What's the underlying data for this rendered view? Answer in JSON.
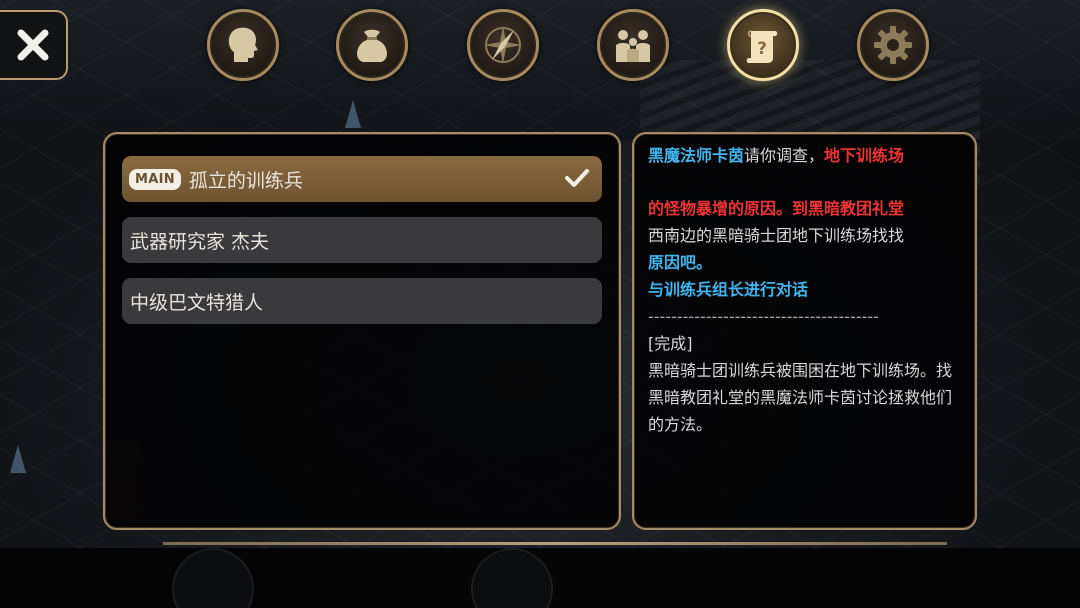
{
  "tabs": [
    {
      "icon": "head-profile-icon",
      "active": false
    },
    {
      "icon": "bag-icon",
      "active": false
    },
    {
      "icon": "compass-icon",
      "active": false
    },
    {
      "icon": "party-icon",
      "active": false
    },
    {
      "icon": "quest-scroll-icon",
      "active": true
    },
    {
      "icon": "gear-icon",
      "active": false
    }
  ],
  "quests": [
    {
      "badge": "MAIN",
      "title": "孤立的训练兵",
      "selected": true
    },
    {
      "badge": "",
      "title": "武器研究家 杰夫",
      "selected": false
    },
    {
      "badge": "",
      "title": "中级巴文特猎人",
      "selected": false
    }
  ],
  "detail": {
    "intro_npc": "黑魔法师卡茵",
    "intro_text": "请你调查，",
    "intro_place": "地下训练场",
    "cause": "的怪物暴增的原因。到黑暗教团礼堂",
    "location": "西南边的黑暗骑士团地下训练场找找",
    "location_end": "原因吧。",
    "objective": "与训练兵组长进行对话",
    "separator": "----------------------------------------",
    "complete_label": "[完成]",
    "complete_text": "黑暗骑士团训练兵被围困在地下训练场。找黑暗教团礼堂的黑魔法师卡茵讨论拯救他们的方法。"
  },
  "colors": {
    "gold_border": "#a58c68",
    "highlight_blue": "#42b4ee",
    "highlight_red": "#ee3434",
    "selected_quest": "#7a5e38"
  }
}
